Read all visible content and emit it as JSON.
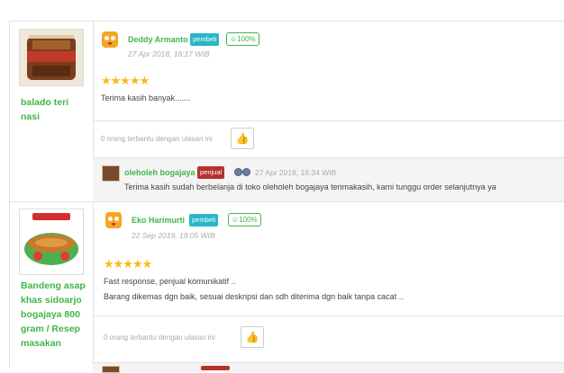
{
  "reviews": [
    {
      "product_name": "balado teri nasi",
      "reviewer": "Deddy Armanto",
      "badge": "pembeli",
      "rating_pct": "100%",
      "date": "27 Apr 2018, 16:17 WIB",
      "stars": "★★★★★",
      "rating": 5,
      "text_lines": [
        "Terima kasih banyak......."
      ],
      "helpful": "0 orang terbantu dengan ulasan ini",
      "reply": {
        "shop": "oleholeh bogajaya",
        "badge": "penjual",
        "date": "27 Apr 2018, 16:34 WIB",
        "text": "Terima kasih sudah berbelanja di toko oleholeh bogajaya terimakasih, kami tunggu order selanjutnya ya"
      }
    },
    {
      "product_name": "Bandeng asap khas sidoarjo bogajaya 800 gram / Resep masakan",
      "reviewer": "Eko Harimurti",
      "badge": "pembeli",
      "rating_pct": "100%",
      "date": "22 Sep 2019, 19:05 WIB",
      "stars": "★★★★★",
      "rating": 5,
      "text_lines": [
        "Fast response, penjual komunikatif ..",
        "Barang dikemas dgn baik, sesuai deskripsi dan sdh diterima dgn baik tanpa cacat .."
      ],
      "helpful": "0 orang terbantu dengan ulasan ini"
    }
  ],
  "icons": {
    "like": "thumbs-up-icon",
    "avatar": "smiley-avatar-icon",
    "percent": "smile-percent-icon"
  },
  "colors": {
    "green": "#42b549",
    "pembeli": "#2ab6c7",
    "penjual": "#b5322c",
    "star": "#f9b91a"
  }
}
